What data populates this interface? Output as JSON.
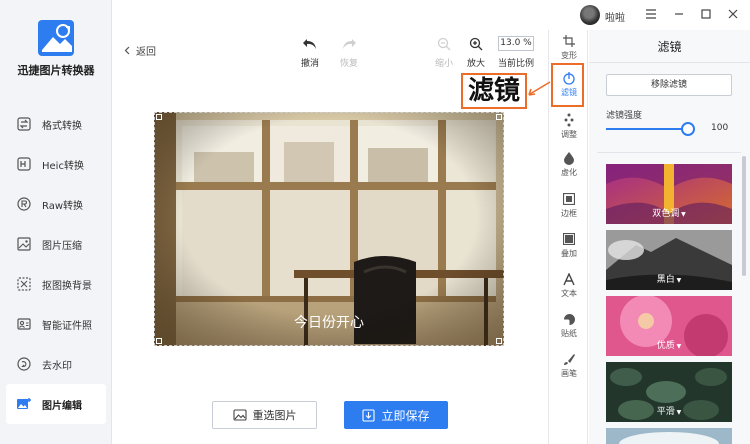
{
  "app": {
    "title": "迅捷图片转换器",
    "colors": {
      "accent": "#2d7cf0",
      "highlight": "#ec6d2a"
    }
  },
  "sidebar": {
    "items": [
      {
        "label": "格式转换",
        "icon": "format-convert-icon"
      },
      {
        "label": "Heic转换",
        "icon": "heic-convert-icon"
      },
      {
        "label": "Raw转换",
        "icon": "raw-convert-icon"
      },
      {
        "label": "图片压缩",
        "icon": "image-compress-icon"
      },
      {
        "label": "抠图换背景",
        "icon": "cutout-icon"
      },
      {
        "label": "智能证件照",
        "icon": "id-photo-icon"
      },
      {
        "label": "去水印",
        "icon": "remove-watermark-icon"
      },
      {
        "label": "图片编辑",
        "icon": "image-edit-icon",
        "active": true
      }
    ]
  },
  "titlebar": {
    "username": "啦啦"
  },
  "toolbar": {
    "back": "返回",
    "undo": "撤消",
    "redo": "恢复",
    "zoom_out": "缩小",
    "zoom_in": "放大",
    "zoom_value": "13.0 %",
    "zoom_label": "当前比例"
  },
  "canvas": {
    "caption": "今日份开心"
  },
  "actions": {
    "reselect": "重选图片",
    "save": "立即保存"
  },
  "strip": {
    "items": [
      {
        "label": "变形",
        "icon": "crop-icon"
      },
      {
        "label": "滤镜",
        "icon": "filter-icon",
        "active": true
      },
      {
        "label": "调整",
        "icon": "adjust-icon"
      },
      {
        "label": "虚化",
        "icon": "blur-icon"
      },
      {
        "label": "边框",
        "icon": "frame-icon"
      },
      {
        "label": "叠加",
        "icon": "overlay-icon"
      },
      {
        "label": "文本",
        "icon": "text-icon"
      },
      {
        "label": "贴纸",
        "icon": "sticker-icon"
      },
      {
        "label": "画笔",
        "icon": "brush-icon"
      }
    ]
  },
  "callout": {
    "text": "滤镜"
  },
  "panel": {
    "title": "滤镜",
    "remove_filter": "移除滤镜",
    "strength_label": "滤镜强度",
    "strength_value": "100",
    "strength_fraction": 1.0,
    "filters": [
      {
        "label": "双色调"
      },
      {
        "label": "黑白"
      },
      {
        "label": "优质"
      },
      {
        "label": "平滑"
      }
    ]
  }
}
